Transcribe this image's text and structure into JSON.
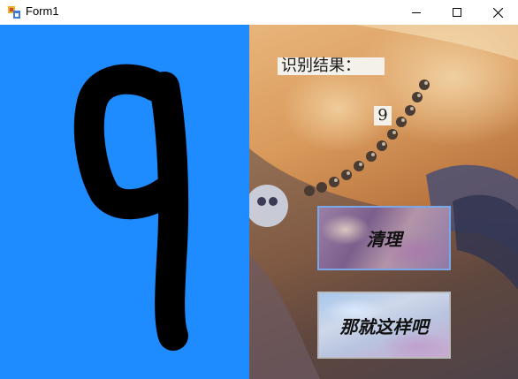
{
  "window": {
    "title": "Form1",
    "controls": {
      "minimize_icon": "minimize-icon",
      "maximize_icon": "maximize-icon",
      "close_icon": "close-icon"
    }
  },
  "drawing_canvas": {
    "background_color": "#1e8cff",
    "stroke_color": "#000000",
    "drawn_digit": "9"
  },
  "result": {
    "label": "识别结果：",
    "value": "9"
  },
  "buttons": {
    "clear_label": "清理",
    "submit_label": "那就这样吧"
  }
}
